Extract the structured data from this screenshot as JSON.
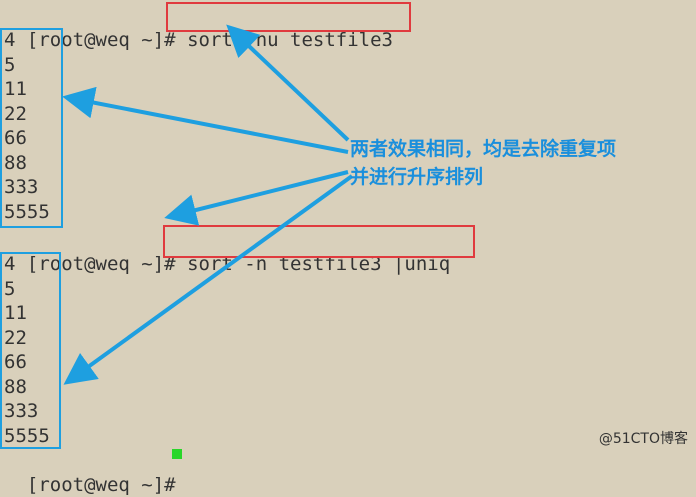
{
  "terminal": {
    "prompt": "[root@weq ~]#",
    "command1": "sort -nu testfile3",
    "output1": [
      "4",
      "5",
      "11",
      "22",
      "66",
      "88",
      "333",
      "5555"
    ],
    "command2": "sort -n testfile3 |uniq",
    "output2": [
      "4",
      "5",
      "11",
      "22",
      "66",
      "88",
      "333",
      "5555"
    ],
    "prompt_last": "[root@weq ~]#"
  },
  "annotation": {
    "line1": "两者效果相同，均是去除重复项",
    "line2": "并进行升序排列"
  },
  "watermark": "@51CTO博客",
  "colors": {
    "background": "#d9d0bb",
    "highlight_red": "#e03a3e",
    "highlight_blue": "#1e9fe0",
    "annotation_text": "#1a8fdc",
    "cursor": "#29d629"
  }
}
